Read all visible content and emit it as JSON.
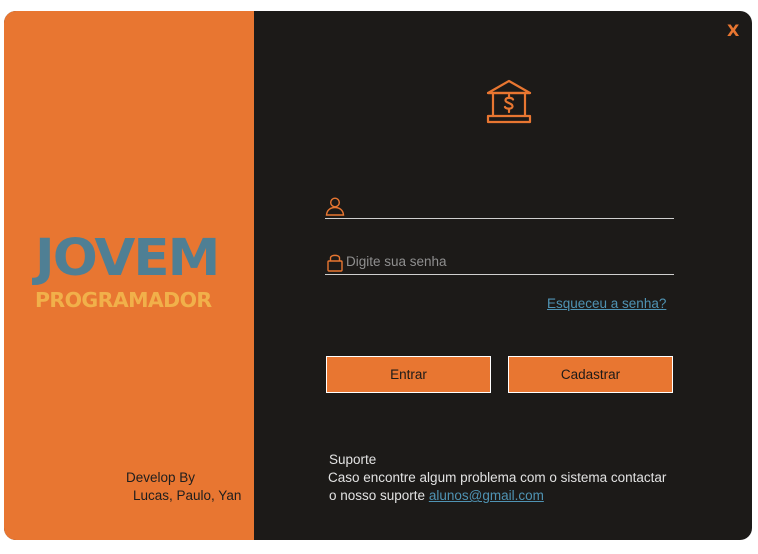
{
  "brand": {
    "line1": "JOVEM",
    "line2": "PROGRAMADOR"
  },
  "credits": {
    "label": "Develop By",
    "names": "Lucas, Paulo, Yan"
  },
  "window": {
    "close_label": "X"
  },
  "login": {
    "header_icon": "bank-icon",
    "username": {
      "icon": "user-icon",
      "value": "",
      "placeholder": ""
    },
    "password": {
      "icon": "lock-icon",
      "value": "",
      "placeholder": "Digite sua senha"
    },
    "forgot_label": "Esqueceu a senha?",
    "login_button": "Entrar",
    "register_button": "Cadastrar"
  },
  "support": {
    "title": "Suporte",
    "line1": "Caso encontre algum problema com o sistema contactar",
    "line2_prefix": "o nosso suporte",
    "email": "alunos@gmail.com"
  },
  "colors": {
    "accent": "#e87631",
    "background": "#1c1a18",
    "logo_blue": "#4f7f94",
    "logo_yellow": "#f1b04a",
    "link": "#4f93b3"
  }
}
